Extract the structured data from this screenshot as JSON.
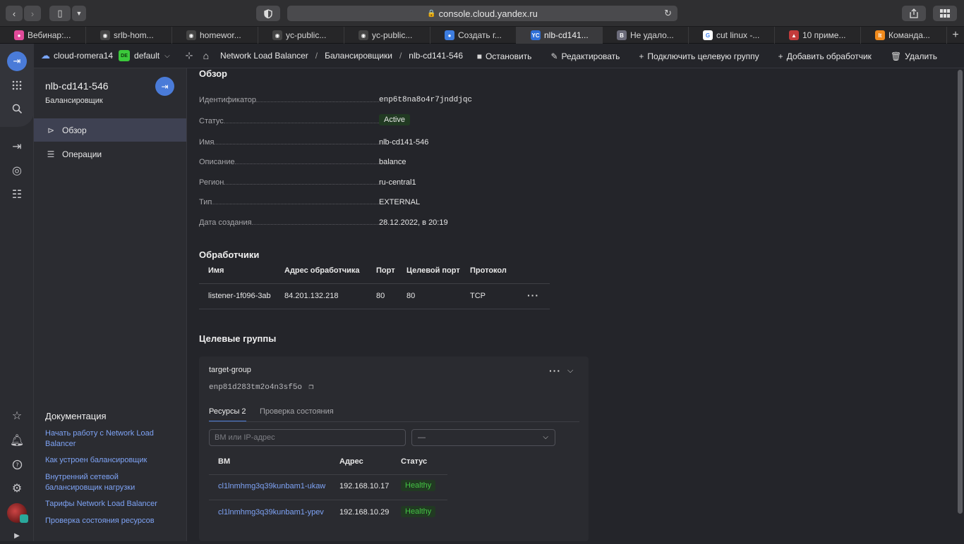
{
  "browser": {
    "url": "console.cloud.yandex.ru",
    "tabs": [
      {
        "label": "Вебинар:...",
        "color": "#e04b9a",
        "glyph": "●"
      },
      {
        "label": "srlb-hom...",
        "color": "#444",
        "glyph": "◉"
      },
      {
        "label": "homewor...",
        "color": "#444",
        "glyph": "◉"
      },
      {
        "label": "yc-public...",
        "color": "#444",
        "glyph": "◉"
      },
      {
        "label": "yc-public...",
        "color": "#444",
        "glyph": "◉"
      },
      {
        "label": "Создать г...",
        "color": "#3d7de0",
        "glyph": "●"
      },
      {
        "label": "nlb-cd141...",
        "color": "#2f6fd6",
        "glyph": "YC"
      },
      {
        "label": "Не удало...",
        "color": "#6b6b7a",
        "glyph": "B"
      },
      {
        "label": "cut linux -...",
        "color": "#ffffff",
        "glyph": "G"
      },
      {
        "label": "10 приме...",
        "color": "#c23b3b",
        "glyph": "▲"
      },
      {
        "label": "Команда...",
        "color": "#f08a1c",
        "glyph": "lt"
      }
    ],
    "active_tab": 6
  },
  "topbar": {
    "cloud": "cloud-romera14",
    "folder_badge": "DE",
    "folder": "default",
    "breadcrumbs": [
      "Network Load Balancer",
      "Балансировщики",
      "nlb-cd141-546"
    ],
    "actions": [
      {
        "icon": "■",
        "label": "Остановить",
        "name": "stop-button"
      },
      {
        "icon": "✎",
        "label": "Редактировать",
        "name": "edit-button"
      },
      {
        "icon": "+",
        "label": "Подключить целевую группу",
        "name": "attach-target-group-button"
      },
      {
        "icon": "+",
        "label": "Добавить обработчик",
        "name": "add-listener-button"
      },
      {
        "icon": "🗑",
        "label": "Удалить",
        "name": "delete-button"
      }
    ]
  },
  "sidenav": {
    "title": "nlb-cd141-546",
    "subtitle": "Балансировщик",
    "items": [
      {
        "label": "Обзор",
        "icon": "⊳"
      },
      {
        "label": "Операции",
        "icon": "☰"
      }
    ],
    "docs_title": "Документация",
    "docs": [
      "Начать работу с Network Load Balancer",
      "Как устроен балансировщик",
      "Внутренний сетевой балансировщик нагрузки",
      "Тарифы Network Load Balancer",
      "Проверка состояния ресурсов"
    ]
  },
  "overview": {
    "title": "Обзор",
    "props": [
      {
        "key": "Идентификатор",
        "value": "enp6t8na8o4r7jnddjqc"
      },
      {
        "key": "Статус",
        "value": "Active"
      },
      {
        "key": "Имя",
        "value": "nlb-cd141-546"
      },
      {
        "key": "Описание",
        "value": "balance"
      },
      {
        "key": "Регион",
        "value": "ru-central1"
      },
      {
        "key": "Тип",
        "value": "EXTERNAL"
      },
      {
        "key": "Дата создания",
        "value": "28.12.2022, в 20:19"
      }
    ]
  },
  "listeners": {
    "title": "Обработчики",
    "columns": [
      "Имя",
      "Адрес обработчика",
      "Порт",
      "Целевой порт",
      "Протокол"
    ],
    "rows": [
      [
        "listener-1f096-3ab",
        "84.201.132.218",
        "80",
        "80",
        "TCP"
      ]
    ]
  },
  "target_groups": {
    "title": "Целевые группы",
    "group": {
      "name": "target-group",
      "id": "enp81d283tm2o4n3sf5o",
      "tabs": [
        "Ресурсы 2",
        "Проверка состояния"
      ],
      "search_placeholder": "ВМ или IP-адрес",
      "select_value": "—",
      "columns": [
        "ВМ",
        "Адрес",
        "Статус"
      ],
      "rows": [
        [
          "cl1lnmhmg3q39kunbam1-ukaw",
          "192.168.10.17",
          "Healthy"
        ],
        [
          "cl1lnmhmg3q39kunbam1-ypev",
          "192.168.10.29",
          "Healthy"
        ]
      ]
    }
  }
}
